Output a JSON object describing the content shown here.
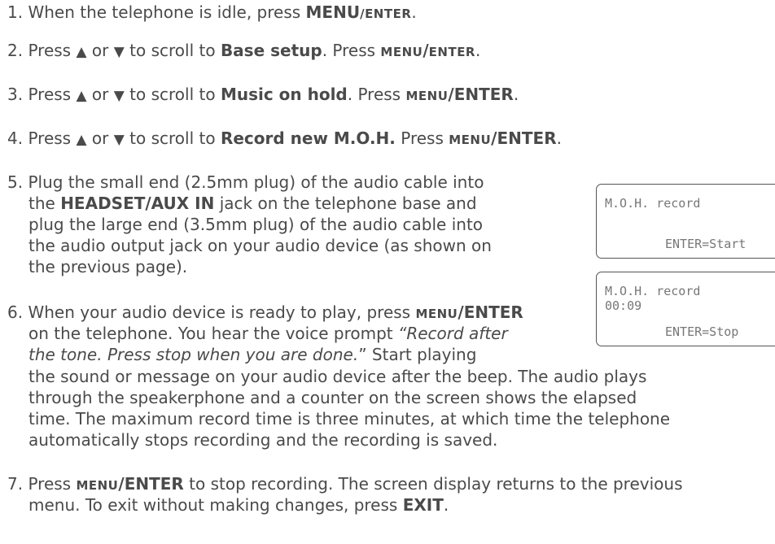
{
  "steps": {
    "s1": {
      "num": "1.",
      "t1": "When the telephone is idle, press ",
      "menu": "MENU",
      "sl": "/",
      "enter": "ENTER",
      "t2": "."
    },
    "s2": {
      "num": "2.",
      "t1": "Press ",
      "up": "▲",
      "or": " or ",
      "down": "▼",
      "t2": " to scroll to ",
      "b1": "Base setup",
      "t3": ". Press ",
      "menu": "MENU",
      "sl": "/",
      "enter": "ENTER",
      "t4": "."
    },
    "s3": {
      "num": "3.",
      "t1": "Press ",
      "up": "▲",
      "or": " or ",
      "down": "▼",
      "t2": " to scroll to ",
      "b1": "Music on hold",
      "t3": ". Press ",
      "menu": "MENU",
      "sl": "/",
      "enter": "ENTER",
      "t4": "."
    },
    "s4": {
      "num": "4.",
      "t1": "Press ",
      "up": "▲",
      "or": " or ",
      "down": "▼",
      "t2": " to scroll to ",
      "b1": "Record new M.O.H.",
      "t3": " Press ",
      "menu": "MENU",
      "sl": "/",
      "enter": "ENTER",
      "t4": "."
    },
    "s5": {
      "num": "5.",
      "l1": "Plug the small end (2.5mm plug) of the audio cable into",
      "l2a": "the ",
      "l2b": "HEADSET/AUX IN",
      "l2c": " jack on the telephone base and",
      "l3": "plug the large end (3.5mm plug) of the audio cable into",
      "l4": "the audio output jack on your audio device (as shown on",
      "l5": "the previous page)."
    },
    "s6": {
      "num": "6.",
      "l1a": "When your audio device is ready to play, press ",
      "menu": "MENU",
      "sl": "/",
      "enter": "ENTER",
      "l2a": "on the telephone. You hear the voice prompt ",
      "l2i": "“Record after",
      "l3i": "the tone. Press stop when you are done.",
      "l3b": "” Start playing",
      "l4": "the sound or message on your audio device after the beep. The audio plays",
      "l5": "through the speakerphone and a counter on the screen shows the elapsed",
      "l6": "time. The maximum record time is three minutes, at which time the telephone",
      "l7": "automatically stops recording and the recording is saved."
    },
    "s7": {
      "num": "7.",
      "l1a": "Press ",
      "menu": "MENU",
      "sl": "/",
      "enter": "ENTER",
      "l1b": " to stop recording. The screen display returns to the previous",
      "l2a": "menu. To exit without making changes, press ",
      "exit": "EXIT",
      "l2b": "."
    }
  },
  "screens": {
    "start": {
      "line1": "M.O.H. record",
      "line3": "ENTER=Start"
    },
    "stop": {
      "line1": "M.O.H. record",
      "line2": "00:09",
      "line3": "ENTER=Stop"
    }
  }
}
